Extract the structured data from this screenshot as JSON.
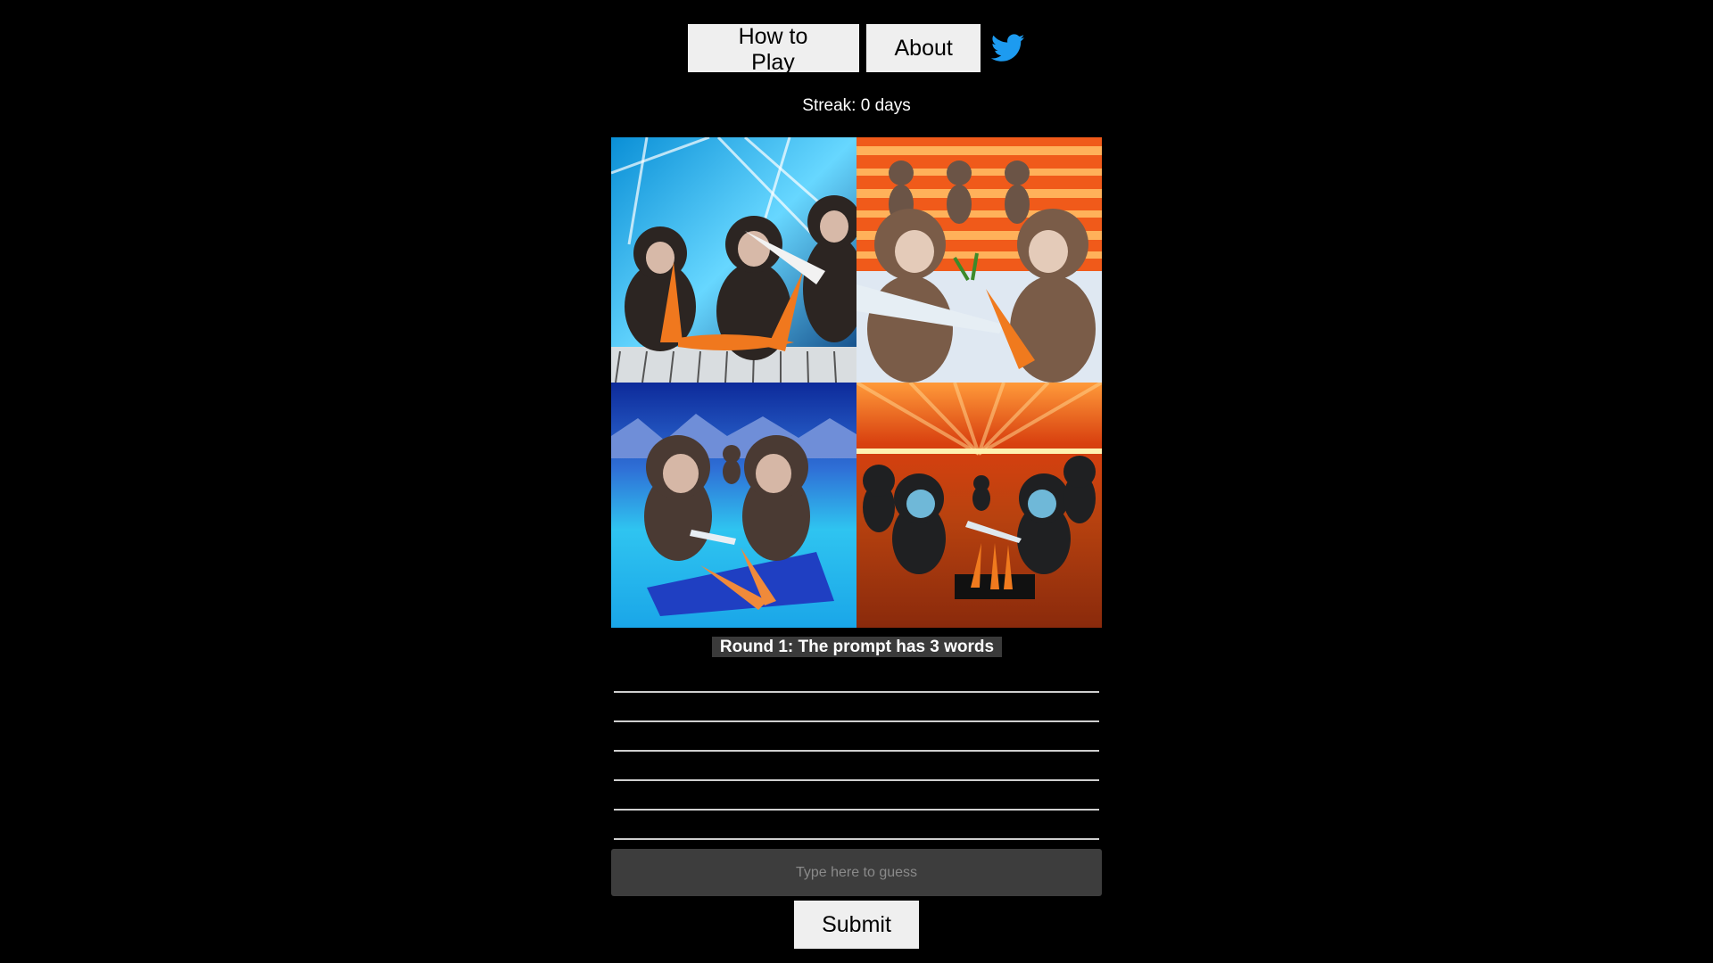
{
  "nav": {
    "how_to_play_label": "How to Play",
    "about_label": "About",
    "twitter_icon": "twitter-bird-icon",
    "twitter_color": "#1d9bf0"
  },
  "streak": {
    "text": "Streak: 0 days"
  },
  "images": [
    {
      "name": "image-1",
      "icon": "monkeys-carrots-blue-neon"
    },
    {
      "name": "image-2",
      "icon": "monkeys-knife-carrot-red-stripes"
    },
    {
      "name": "image-3",
      "icon": "monkeys-cutting-board-blue-ice"
    },
    {
      "name": "image-4",
      "icon": "monkeys-carrots-orange-rays"
    }
  ],
  "round": {
    "label": "Round 1: The prompt has 3 words"
  },
  "guesses": {
    "slots": 6
  },
  "input": {
    "placeholder": "Type here to guess",
    "value": ""
  },
  "submit": {
    "label": "Submit"
  }
}
